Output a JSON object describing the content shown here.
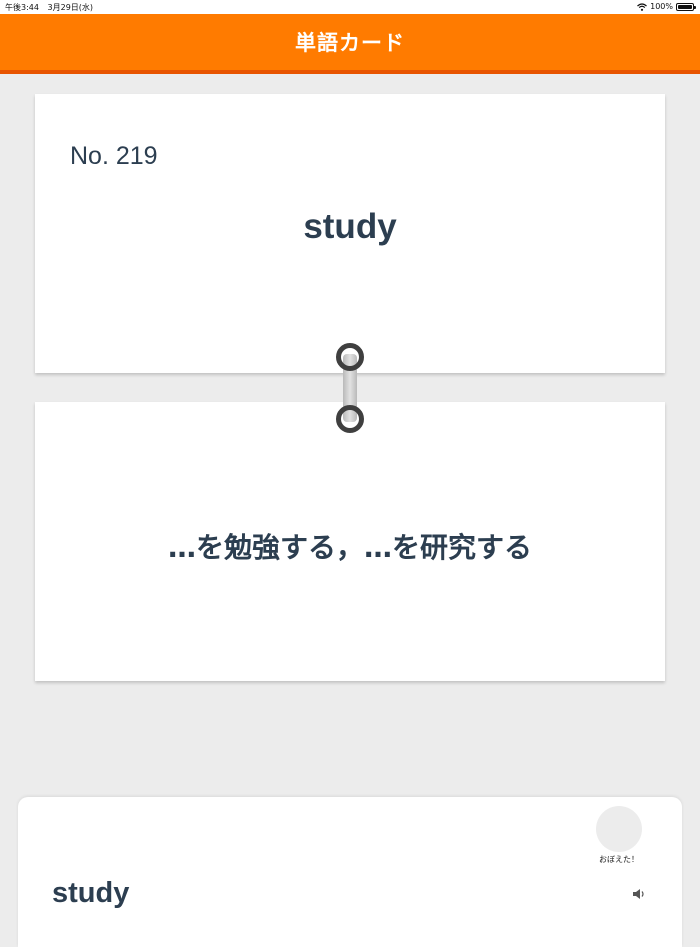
{
  "status_bar": {
    "time": "午後3:44",
    "date": "3月29日(水)",
    "battery": "100%",
    "wifi_icon": "wifi-icon",
    "battery_icon": "battery-icon"
  },
  "header": {
    "title": "単語カード",
    "color": "#ff7b00",
    "border_color": "#e85400"
  },
  "card_front": {
    "number": "No. 219",
    "word": "study"
  },
  "card_back": {
    "meaning": "…を勉強する，…を研究する"
  },
  "ring_icon": "binder-ring-icon",
  "bottom_panel": {
    "memorized_label": "おぼえた！",
    "word": "study",
    "speaker_icon": "speaker-icon"
  },
  "colors": {
    "text": "#2c3e50",
    "background": "#ececec"
  }
}
